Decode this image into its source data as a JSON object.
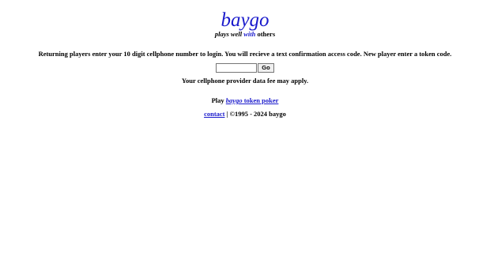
{
  "logo": {
    "text": "baygo"
  },
  "tagline": {
    "part1": "plays well ",
    "part2": "with",
    "part3": " others"
  },
  "instructions": "Returning players enter your 10 digit cellphone number to login. You will recieve a text confirmation access code. New player enter a token code.",
  "login": {
    "phone_value": "",
    "go_label": "Go"
  },
  "fee_note": "Your cellphone provider data fee may apply.",
  "play": {
    "prefix": "Play ",
    "brand": "baygo",
    "rest": " token poker"
  },
  "footer": {
    "contact_label": "contact",
    "separator": " | ",
    "copyright": "©1995 - 2024 baygo"
  },
  "colors": {
    "link": "#1a1acc",
    "text": "#000000",
    "background": "#ffffff"
  }
}
